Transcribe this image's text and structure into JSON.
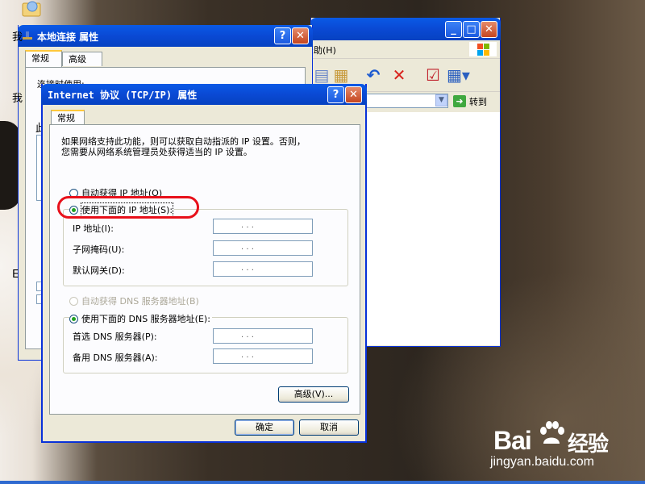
{
  "explorer": {
    "menu_help": "帮助(H)",
    "goto_label": "转到"
  },
  "lan_window": {
    "title": "本地连接 属性",
    "tabs": [
      "常规",
      "高级"
    ],
    "connect_using": "连接时使用:",
    "partial_labels": [
      "此",
      "我",
      "我",
      "E"
    ]
  },
  "tcp_dialog": {
    "title": "Internet 协议 (TCP/IP) 属性",
    "tab": "常规",
    "description": "如果网络支持此功能，则可以获取自动指派的 IP 设置。否则，\n您需要从网络系统管理员处获得适当的 IP 设置。",
    "radio_auto_ip": "自动获得 IP 地址(O)",
    "radio_manual_ip": "使用下面的 IP 地址(S):",
    "label_ip": "IP 地址(I):",
    "label_mask": "子网掩码(U):",
    "label_gateway": "默认网关(D):",
    "radio_auto_dns": "自动获得 DNS 服务器地址(B)",
    "radio_manual_dns": "使用下面的 DNS 服务器地址(E):",
    "label_dns1": "首选 DNS 服务器(P):",
    "label_dns2": "备用 DNS 服务器(A):",
    "ip_dots": ".   .   .",
    "advanced_button": "高级(V)...",
    "ok_button": "确定",
    "cancel_button": "取消",
    "selected_ip_mode": "manual",
    "selected_dns_mode": "manual"
  },
  "watermark": {
    "brand": "Bai",
    "brand_tail": "经验",
    "url": "jingyan.baidu.com"
  },
  "colors": {
    "titlebar": "#0a49d4",
    "highlight_ring": "#e8101a",
    "radio_on": "#21a121"
  }
}
